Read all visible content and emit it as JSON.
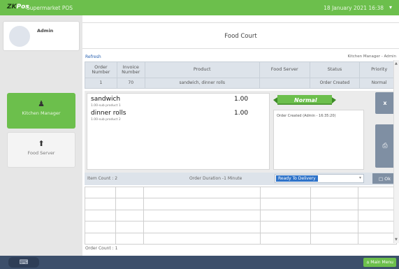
{
  "app": {
    "logo_text": "ZK",
    "logo_suffix": "Pos",
    "title": "Supermarket POS",
    "datetime": "18 January 2021 16:38",
    "menu_arrow": "▾"
  },
  "sidebar": {
    "user_name": "Admin",
    "items": [
      {
        "label": "Kitchen Manager",
        "icon": "♟",
        "icon_name": "chef-icon",
        "active": true
      },
      {
        "label": "Food Server",
        "icon": "⬆",
        "icon_name": "server-icon",
        "active": false
      }
    ]
  },
  "page": {
    "title": "Food Court",
    "refresh_label": "Refresh",
    "role_label": "Kitchen Manager - Admin"
  },
  "grid": {
    "headers": [
      "Order Number",
      "Invoice Number",
      "Product",
      "Food Server",
      "Status",
      "Priority"
    ],
    "rows": [
      {
        "order": "1",
        "invoice": "70",
        "product": "sandwich, dinner rolls",
        "server": "",
        "status": "Order Created",
        "priority": "Normal"
      }
    ]
  },
  "detail": {
    "items": [
      {
        "name": "sandwich",
        "price": "1.00",
        "sub": "1.00-sub product 1"
      },
      {
        "name": "dinner rolls",
        "price": "1.00",
        "sub": "1.00-sub product 2"
      }
    ],
    "priority_banner": "Normal",
    "log": "Order Created (Admin - 16:35:20)",
    "close_label": "x",
    "print_icon": "⎙",
    "item_count": "Item Count : 2",
    "duration": "Order Duration -1   Minute",
    "status_selected": "Ready To Delivery",
    "ok_label": "Ok",
    "ok_icon": "□"
  },
  "order_count": "Order Count  : 1",
  "footer": {
    "keyboard_icon": "⌨",
    "main_menu_label": "Main Menu",
    "main_menu_icon": "⌂"
  },
  "colors": {
    "green": "#6cbf4c",
    "navy": "#3c4f6b",
    "button_gray": "#7f8fa3",
    "header_gray": "#dde3ea",
    "select_blue": "#2f73c9"
  }
}
